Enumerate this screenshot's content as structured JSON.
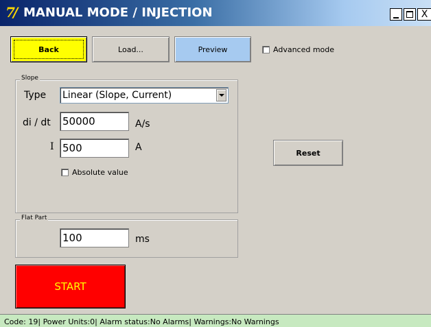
{
  "window": {
    "title": "MANUAL MODE / INJECTION",
    "logo_glyph": "7/",
    "controls": {
      "minimize": "_",
      "maximize": "□",
      "close": "X"
    }
  },
  "toolbar": {
    "back_label": "Back",
    "load_label": "Load...",
    "preview_label": "Preview",
    "advanced_mode_label": "Advanced mode",
    "advanced_mode_checked": false
  },
  "slope": {
    "legend": "Slope",
    "type_label": "Type",
    "type_value": "Linear (Slope, Current)",
    "didt_label": "di / dt",
    "didt_value": "50000",
    "didt_unit": "A/s",
    "i_label": "I",
    "i_value": "500",
    "i_unit": "A",
    "absolute_label": "Absolute value",
    "absolute_checked": false
  },
  "reset_label": "Reset",
  "flat": {
    "legend": "Flat Part",
    "value": "100",
    "unit": "ms"
  },
  "start_label": "START",
  "status_text": "Code: 19| Power Units:0| Alarm status:No Alarms| Warnings:No Warnings",
  "colors": {
    "back_button": "#ffff00",
    "preview_button": "#a6caf0",
    "start_button": "#ff0000",
    "start_text": "#ffff00",
    "status_bar": "#c7e9c0"
  }
}
